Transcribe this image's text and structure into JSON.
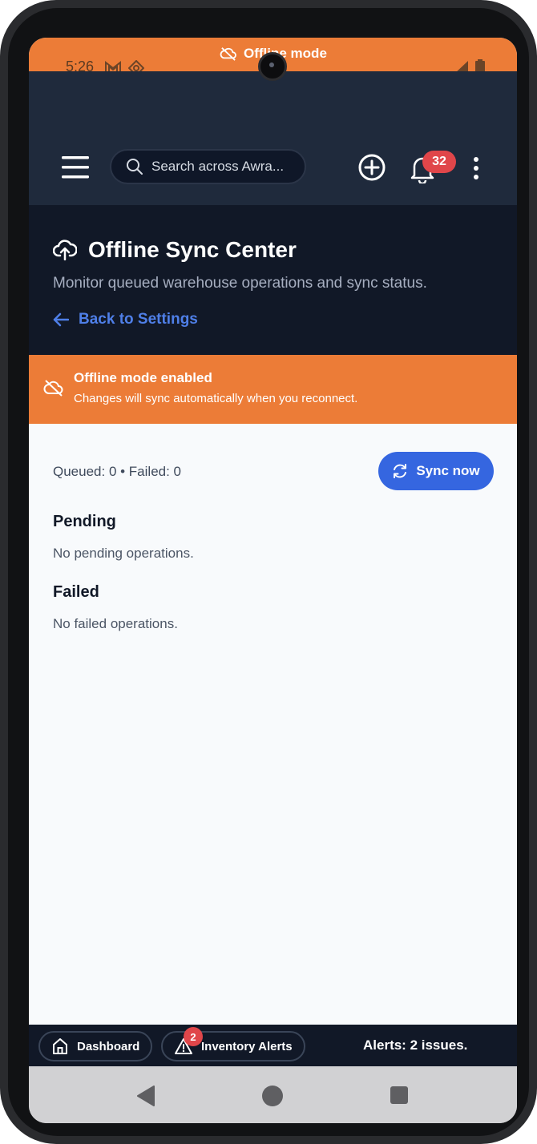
{
  "status_bar": {
    "time": "5:26",
    "offline_label": "Offline mode"
  },
  "app_bar": {
    "search_placeholder": "Search across Awra...",
    "notification_count": "32"
  },
  "header": {
    "title": "Offline Sync Center",
    "subtitle": "Monitor queued warehouse operations and sync status.",
    "back_link": "Back to Settings"
  },
  "banner": {
    "title": "Offline mode enabled",
    "text": "Changes will sync automatically when you reconnect."
  },
  "sync": {
    "counts": "Queued: 0 • Failed: 0",
    "sync_button": "Sync now"
  },
  "sections": {
    "pending_title": "Pending",
    "pending_empty": "No pending operations.",
    "failed_title": "Failed",
    "failed_empty": "No failed operations."
  },
  "bottom_bar": {
    "dashboard_label": "Dashboard",
    "inventory_alerts_label": "Inventory Alerts",
    "inventory_alerts_count": "2",
    "alerts_summary": "Alerts: 2 issues."
  },
  "colors": {
    "accent_orange": "#ec7c37",
    "primary_blue": "#3566e0",
    "badge_red": "#e0464a",
    "header_dark": "#111827",
    "appbar": "#1f2a3c"
  }
}
